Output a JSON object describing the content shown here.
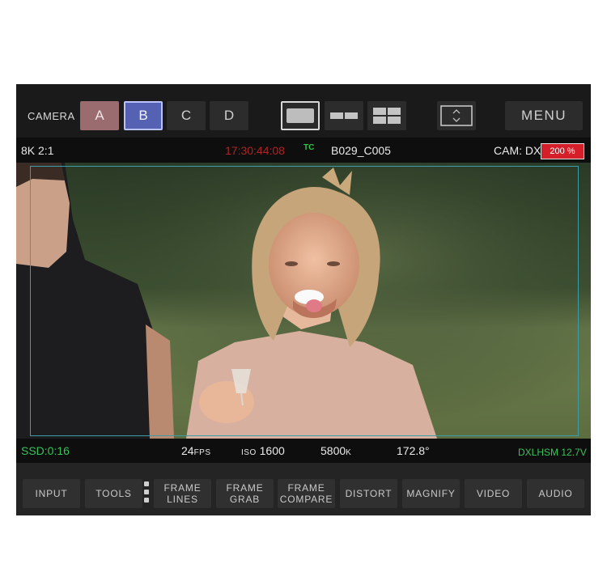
{
  "top_bar": {
    "camera_label": "CAMERA",
    "cameras": [
      "A",
      "B",
      "C",
      "D"
    ],
    "menu_label": "MENU"
  },
  "status": {
    "resolution": "8K 2:1",
    "timecode": "17:30:44:08",
    "tc_tag": "TC",
    "clip_name": "B029_C005",
    "camera_id": "CAM: DXL",
    "zoom": "200 %"
  },
  "info": {
    "ssd": "SSD:0:16",
    "fps_value": "24",
    "fps_unit": "FPS",
    "iso_label": "ISO",
    "iso_value": "1600",
    "wb_value": "5800",
    "wb_unit": "K",
    "shutter": "172.8°",
    "battery": "DXLHSM 12.7V"
  },
  "toolbar": {
    "input": "INPUT",
    "tools": "TOOLS",
    "frame_lines_1": "FRAME",
    "frame_lines_2": "LINES",
    "frame_grab_1": "FRAME",
    "frame_grab_2": "GRAB",
    "frame_compare_1": "FRAME",
    "frame_compare_2": "COMPARE",
    "distort": "DISTORT",
    "magnify": "MAGNIFY",
    "video": "VIDEO",
    "audio": "AUDIO"
  },
  "colors": {
    "camera_a": "#9a6b6f",
    "camera_b_selected": "#5561b3",
    "timecode": "#b22222",
    "status_green": "#36c45a",
    "zoom_badge": "#d41f2b",
    "frame_line": "#3b9da8"
  }
}
